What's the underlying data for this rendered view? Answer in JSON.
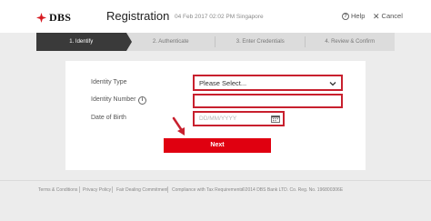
{
  "header": {
    "logo_text": "DBS",
    "title": "Registration",
    "datetime": "04 Feb 2017 02:02 PM Singapore",
    "help_label": "Help",
    "cancel_label": "Cancel"
  },
  "steps": [
    {
      "label": "1. Identify",
      "active": true
    },
    {
      "label": "2. Authenticate",
      "active": false
    },
    {
      "label": "3. Enter Credentials",
      "active": false
    },
    {
      "label": "4. Review & Confirm",
      "active": false
    }
  ],
  "form": {
    "identity_type_label": "Identity Type",
    "identity_type_value": "Please Select...",
    "identity_number_label": "Identity Number",
    "identity_number_value": "",
    "dob_label": "Date of Birth",
    "dob_placeholder": "DD/MM/YYYY",
    "next_label": "Next"
  },
  "footer": {
    "links": [
      "Terms & Conditions",
      "Privacy Policy",
      "Fair Dealing Commitment",
      "Compliance with Tax Requirements"
    ],
    "copyright": "©2014 DBS Bank LTD. Co. Reg. No. 196800306E"
  },
  "colors": {
    "brand_red": "#e00010",
    "highlight_red": "#c8202e",
    "active_step": "#3a3a3a"
  }
}
